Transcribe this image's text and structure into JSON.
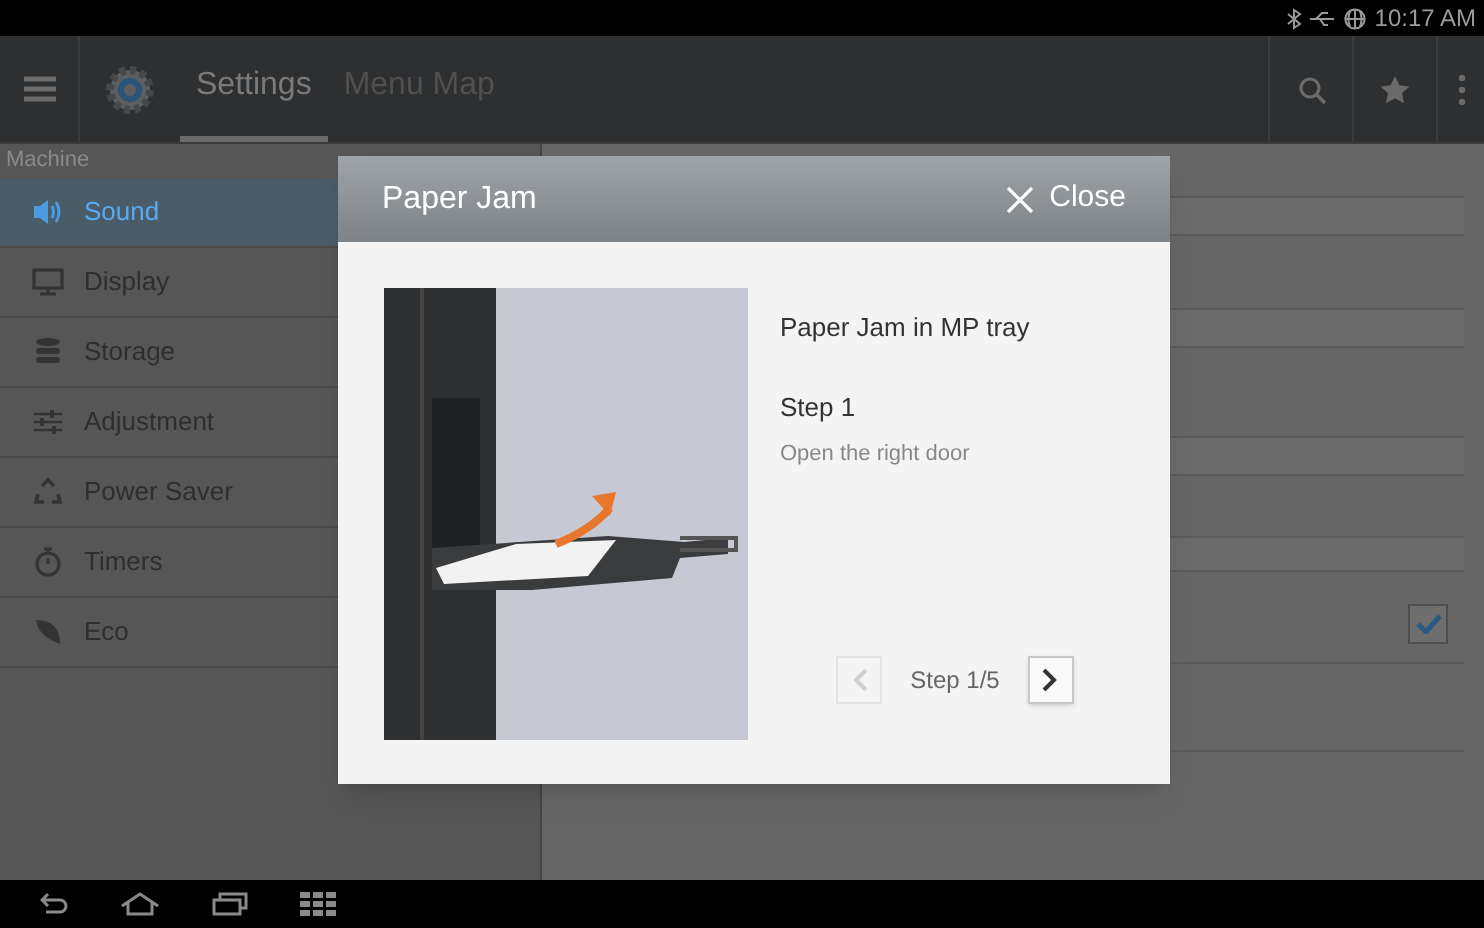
{
  "status_bar": {
    "time": "10:17 AM"
  },
  "app_bar": {
    "tabs": [
      {
        "label": "Settings",
        "selected": true
      },
      {
        "label": "Menu Map",
        "selected": false
      }
    ]
  },
  "sidebar": {
    "section": "Machine",
    "items": [
      {
        "label": "Sound",
        "kind": "sound",
        "selected": true
      },
      {
        "label": "Display",
        "kind": "display",
        "selected": false
      },
      {
        "label": "Storage",
        "kind": "storage",
        "selected": false
      },
      {
        "label": "Adjustment",
        "kind": "adjustment",
        "selected": false
      },
      {
        "label": "Power Saver",
        "kind": "power",
        "selected": false
      },
      {
        "label": "Timers",
        "kind": "timers",
        "selected": false
      },
      {
        "label": "Eco",
        "kind": "eco",
        "selected": false
      }
    ]
  },
  "detail": {
    "checkbox": {
      "checked": true
    }
  },
  "dialog": {
    "title": "Paper Jam",
    "close": "Close",
    "heading": "Paper Jam in MP tray",
    "step_title": "Step 1",
    "step_text": "Open the right door",
    "pager": {
      "label": "Step 1/5",
      "prev_disabled": true,
      "next_disabled": false
    }
  }
}
